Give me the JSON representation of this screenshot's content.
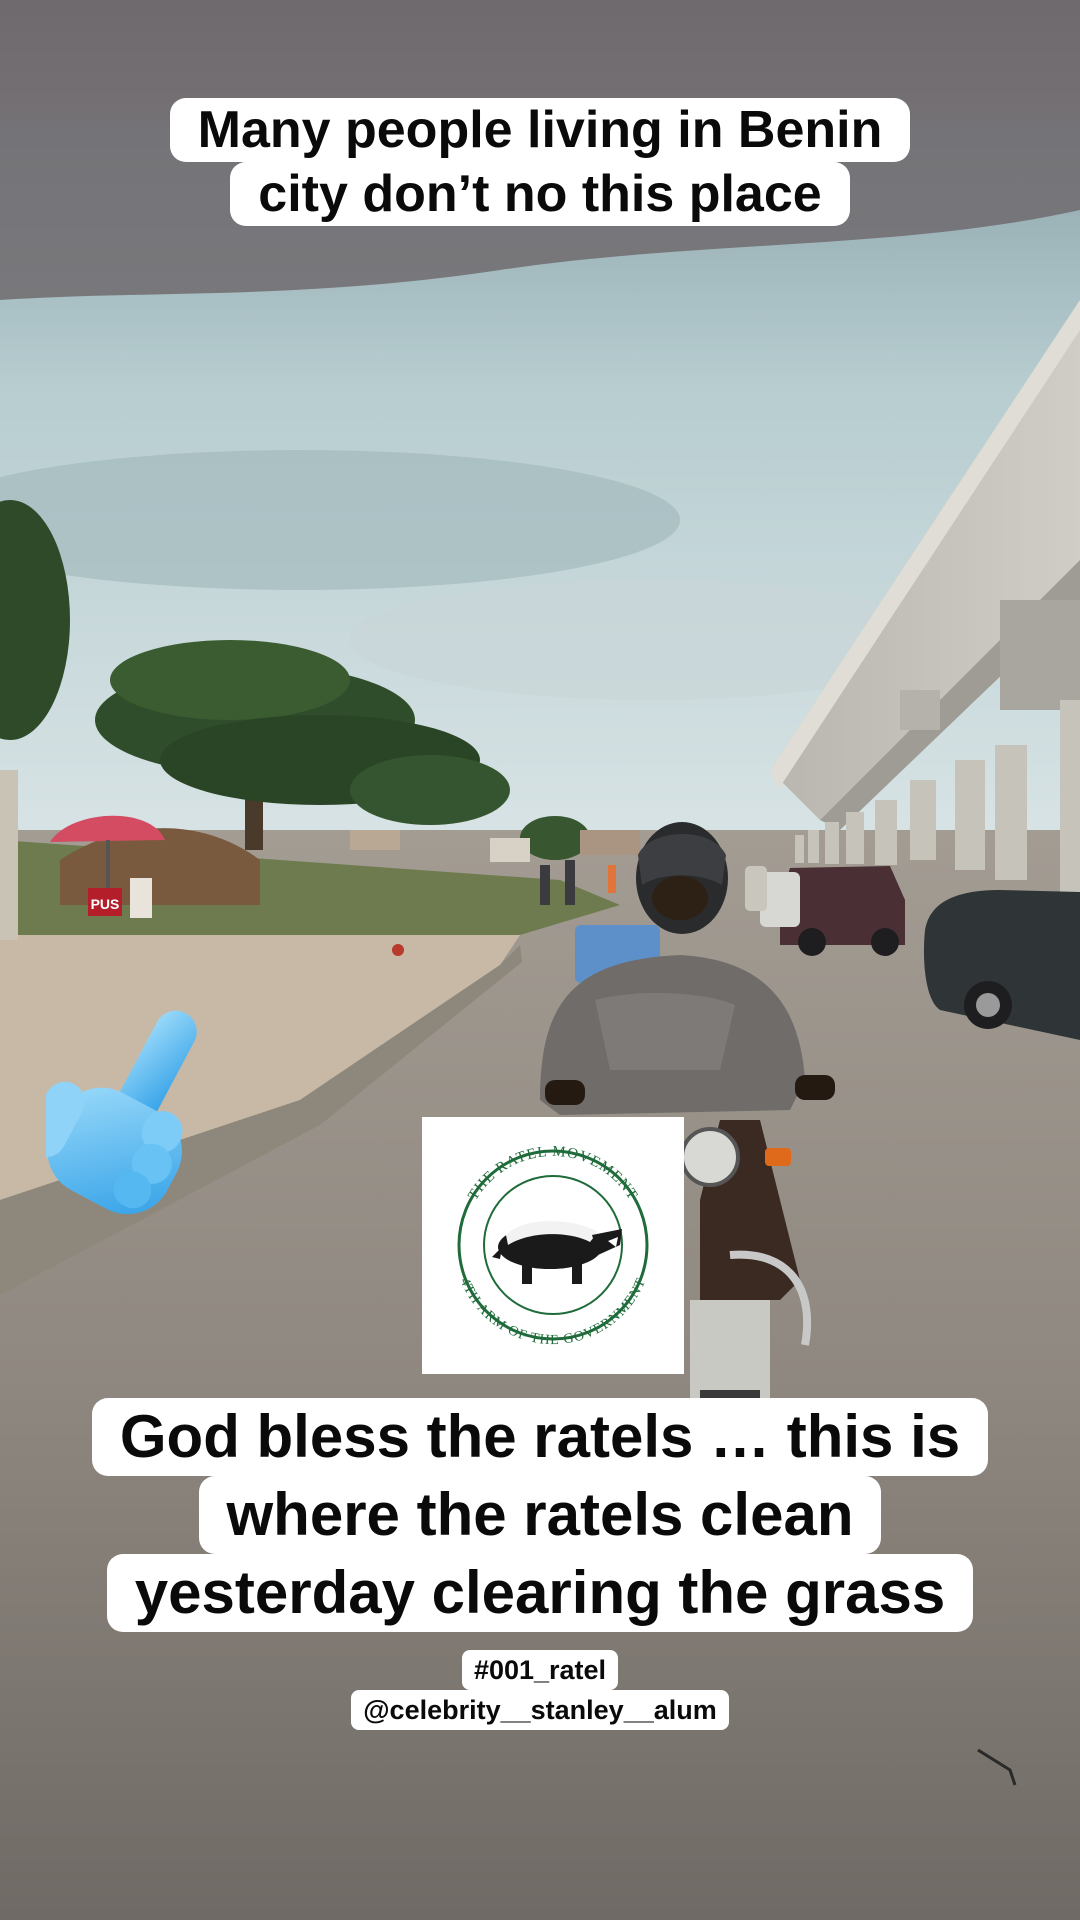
{
  "captions": {
    "top": [
      "Many people living in Benin",
      "city don’t no this place"
    ],
    "bottom": [
      "God bless the ratels … this is",
      "where the ratels clean",
      "yesterday clearing the grass"
    ]
  },
  "tags": {
    "hashtag": "#001_ratel",
    "handle": "@celebrity__stanley__alum"
  },
  "logo": {
    "ring_text_top": "THE RATEL MOVEMENT",
    "ring_text_bottom": "4TH ARM OF THE GOVERNMENT"
  },
  "storefront_sign": "PUS",
  "icons": {
    "pointer": "pointing-hand-icon",
    "badger": "honey-badger-icon"
  },
  "colors": {
    "caption_bg": "#ffffff",
    "caption_text": "#0a0a0a",
    "logo_green": "#1f6b3a",
    "hand_blue": "#5fc0f0"
  }
}
